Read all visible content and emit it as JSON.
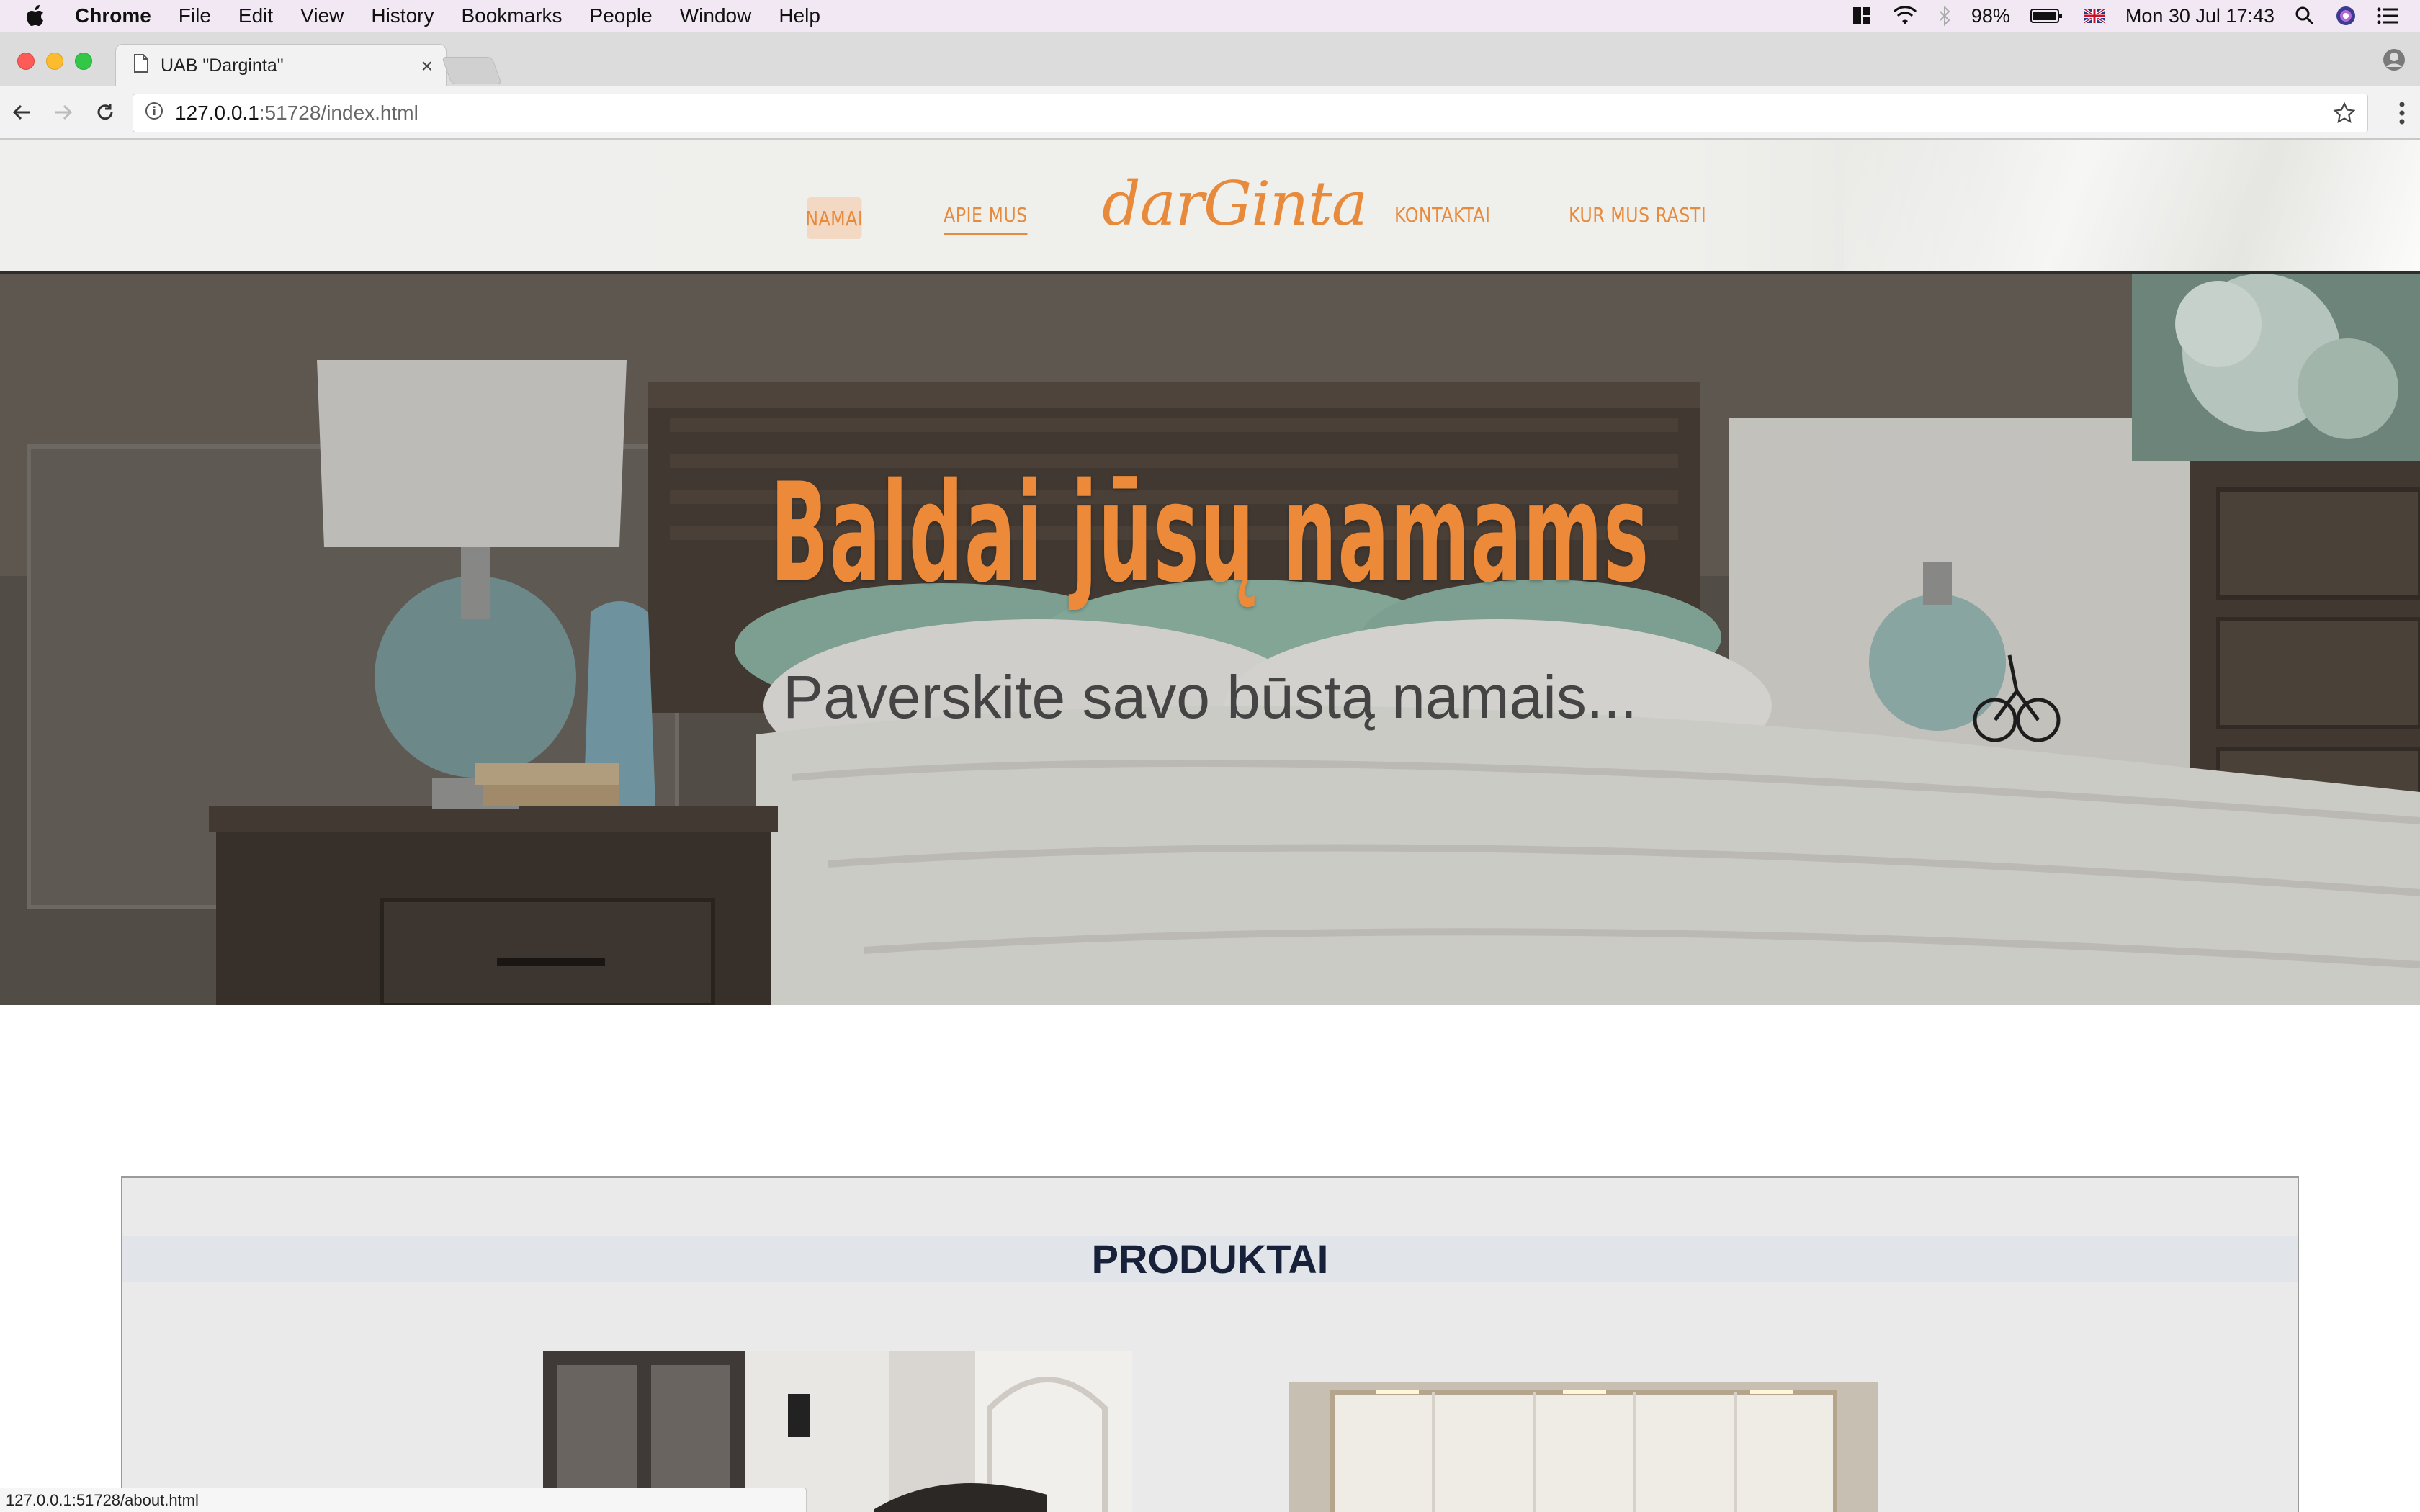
{
  "menubar": {
    "app": "Chrome",
    "items": [
      "File",
      "Edit",
      "View",
      "History",
      "Bookmarks",
      "People",
      "Window",
      "Help"
    ],
    "battery": "98%",
    "clock": "Mon 30 Jul  17:43"
  },
  "browser": {
    "tab_title": "UAB \"Darginta\"",
    "tab_close": "×",
    "url_host": "127.0.0.1",
    "url_path": ":51728/index.html",
    "status_url": "127.0.0.1:51728/about.html"
  },
  "site": {
    "nav": {
      "home": "NAMAI",
      "about": "APIE MUS",
      "contacts": "KONTAKTAI",
      "where": "KUR MUS RASTI"
    },
    "logo": "darGinta",
    "hero": {
      "title": "Baldai jūsų namams",
      "subtitle": "Paverskite savo būstą namais..."
    },
    "products": {
      "heading": "PRODUKTAI"
    }
  },
  "colors": {
    "accent": "#e88a3c",
    "nav_active_bg": "#f3d8c3",
    "heading_dark": "#17223a"
  }
}
